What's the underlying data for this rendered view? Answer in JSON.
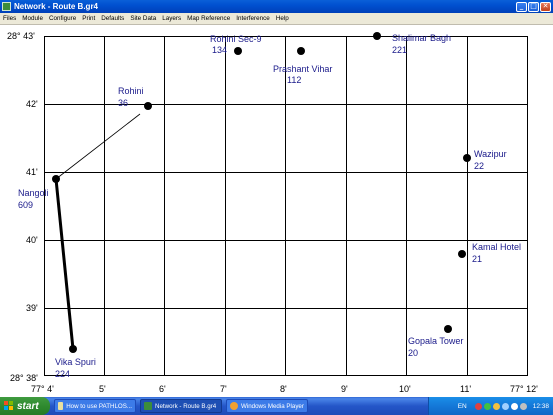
{
  "window": {
    "title": "Network - Route B.gr4",
    "min_icon": "minimize-icon",
    "max_icon": "maximize-icon",
    "close_icon": "close-icon"
  },
  "menu": {
    "items": [
      "Files",
      "Module",
      "Configure",
      "Print",
      "Defaults",
      "Site Data",
      "Layers",
      "Map Reference",
      "Interference",
      "Help"
    ]
  },
  "map": {
    "y_labels": [
      "28° 43'",
      "42'",
      "41'",
      "40'",
      "39'",
      "28° 38'"
    ],
    "x_labels": [
      "77° 4'",
      "5'",
      "6'",
      "7'",
      "8'",
      "9'",
      "10'",
      "11'",
      "77° 12'"
    ],
    "sites": [
      {
        "name": "Rohini Sec-9",
        "id": "134"
      },
      {
        "name": "Shalimar Bagh",
        "id": "221"
      },
      {
        "name": "Prashant Vihar",
        "id": "112"
      },
      {
        "name": "Rohini",
        "id": "36"
      },
      {
        "name": "Wazipur",
        "id": "22"
      },
      {
        "name": "Nangoli",
        "id": "609"
      },
      {
        "name": "Kamal Hotel",
        "id": "21"
      },
      {
        "name": "Gopala Tower",
        "id": "20"
      },
      {
        "name": "Vika Spuri",
        "id": "224"
      }
    ],
    "colors": {
      "site_label": "#1a1a8a",
      "grid": "#000000",
      "link": "#000000"
    }
  },
  "taskbar": {
    "start_label": "start",
    "buttons": [
      "How to use PATHLOS...",
      "Network - Route B.gr4",
      "Windows Media Player"
    ],
    "tray": {
      "language": "EN",
      "time": "12:38"
    }
  }
}
